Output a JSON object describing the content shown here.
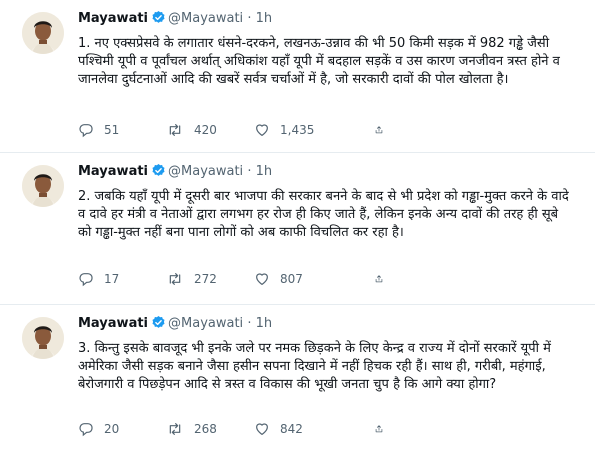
{
  "tweets": [
    {
      "name": "Mayawati",
      "handle": "@Mayawati",
      "dot": "·",
      "time": "1h",
      "text": "1. नए एक्सप्रेसवे के लगातार धंसने-दरकने, लखनऊ-उन्नाव की भी 50 किमी सड़क में 982 गड्ढे जैसी पश्चिमी यूपी व पूर्वांचल अर्थात् अधिकांश यहाँ यूपी में बदहाल सड़कें व उस कारण जनजीवन त्रस्त होने व जानलेवा दुर्घटनाओं आदि की खबरें सर्वत्र चर्चाओं में है, जो सरकारी दावों की पोल खोलता है।",
      "replies": "51",
      "retweets": "420",
      "likes": "1,435"
    },
    {
      "name": "Mayawati",
      "handle": "@Mayawati",
      "dot": "·",
      "time": "1h",
      "text": "2. जबकि यहाँ यूपी में दूसरी बार भाजपा की सरकार बनने के बाद से भी प्रदेश को गड्ढा-मुक्त करने के वादे व दावे हर मंत्री व नेताओं द्वारा लगभग हर रोज ही किए जाते हैं, लेकिन इनके अन्य दावों की तरह ही सूबे को गड्ढा-मुक्त नहीं बना पाना लोगों को अब काफी विचलित कर रहा है।",
      "replies": "17",
      "retweets": "272",
      "likes": "807"
    },
    {
      "name": "Mayawati",
      "handle": "@Mayawati",
      "dot": "·",
      "time": "1h",
      "text": "3. किन्तु इसके बावजूद भी इनके जले पर नमक छिड़कने के लिए केन्द्र व राज्य में दोनों सरकारें यूपी में अमेरिका जैसी सड़क बनाने जैसा हसीन सपना दिखाने में नहीं हिचक रही हैं। साथ ही, गरीबी, महंगाई, बेरोजगारी व पिछड़ेपन आदि से त्रस्त व विकास की भूखी जनता चुप है कि आगे क्या होगा?",
      "replies": "20",
      "retweets": "268",
      "likes": "842"
    }
  ],
  "icons": {
    "verified": "verified-badge-icon",
    "reply": "reply-icon",
    "retweet": "retweet-icon",
    "like": "heart-icon",
    "share": "share-icon"
  },
  "colors": {
    "verified": "#1d9bf0",
    "muted": "#536471",
    "divider": "#e6ecf0",
    "text": "#0f1419"
  }
}
